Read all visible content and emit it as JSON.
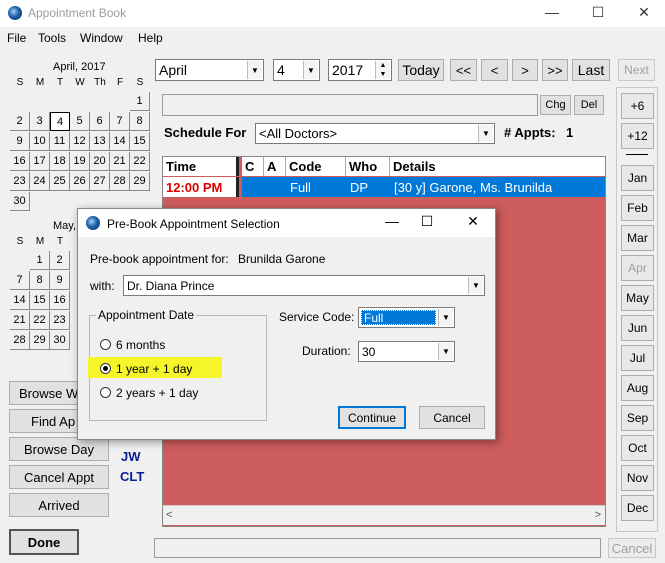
{
  "window": {
    "title": "Appointment Book",
    "minimize": "—",
    "maximize": "☐",
    "close": "✕"
  },
  "menu": [
    "File",
    "Tools",
    "Window",
    "Help"
  ],
  "toolbar": {
    "month": "April",
    "day": "4",
    "year": "2017",
    "today": "Today",
    "prev_prev": "<<",
    "prev": "<",
    "next": ">",
    "next_next": ">>",
    "last": "Last",
    "next_disabled": "Next"
  },
  "note_buttons": {
    "chg": "Chg",
    "del": "Del"
  },
  "schedule": {
    "label": "Schedule For",
    "value": "<All Doctors>",
    "appts_label": "# Appts:",
    "appts_count": "1"
  },
  "grid": {
    "columns": [
      "Time",
      "C",
      "A",
      "Code",
      "Who",
      "Details"
    ],
    "row": {
      "time": "12:00 PM",
      "code": "Full",
      "who": "DP",
      "details": "[30 y] Garone, Ms. Brunilda"
    }
  },
  "calendar_april": {
    "title": "April, 2017",
    "dow": [
      "S",
      "M",
      "T",
      "W",
      "Th",
      "F",
      "S"
    ],
    "weeks": [
      [
        "",
        "",
        "",
        "",
        "",
        "",
        "1"
      ],
      [
        "2",
        "3",
        "4",
        "5",
        "6",
        "7",
        "8"
      ],
      [
        "9",
        "10",
        "11",
        "12",
        "13",
        "14",
        "15"
      ],
      [
        "16",
        "17",
        "18",
        "19",
        "20",
        "21",
        "22"
      ],
      [
        "23",
        "24",
        "25",
        "26",
        "27",
        "28",
        "29"
      ],
      [
        "30",
        "",
        "",
        "",
        "",
        "",
        ""
      ]
    ],
    "selected": "4"
  },
  "calendar_may": {
    "title": "May,",
    "dow": [
      "S",
      "M",
      "T"
    ],
    "weeks": [
      [
        "",
        "1",
        "2"
      ],
      [
        "7",
        "8",
        "9"
      ],
      [
        "14",
        "15",
        "16"
      ],
      [
        "21",
        "22",
        "23"
      ],
      [
        "28",
        "29",
        "30"
      ]
    ]
  },
  "left_buttons": {
    "browse_week": "Browse W",
    "find_appt": "Find Ap",
    "browse_day": "Browse Day",
    "cancel_appt": "Cancel Appt",
    "arrived": "Arrived",
    "done": "Done"
  },
  "provider_codes": [
    "JW",
    "CLT"
  ],
  "right_panel": {
    "plus6": "+6",
    "plus12": "+12",
    "months": [
      "Jan",
      "Feb",
      "Mar",
      "Apr",
      "May",
      "Jun",
      "Jul",
      "Aug",
      "Sep",
      "Oct",
      "Nov",
      "Dec"
    ],
    "disabled_month": "Apr",
    "cancel": "Cancel"
  },
  "dialog": {
    "title": "Pre-Book Appointment Selection",
    "prebook_label": "Pre-book appointment for:",
    "patient": "Brunilda Garone",
    "with_label": "with:",
    "doctor": "Dr. Diana Prince",
    "group_label": "Appointment Date",
    "options": [
      "6 months",
      "1 year + 1 day",
      "2 years + 1 day"
    ],
    "selected_option": "1 year + 1 day",
    "service_label": "Service Code:",
    "service_value": "Full",
    "duration_label": "Duration:",
    "duration_value": "30",
    "continue": "Continue",
    "cancel": "Cancel"
  },
  "colors": {
    "highlight_row": "#0078d7",
    "grid_bg": "#cd5c5c",
    "time_red": "#e00000",
    "highlight_marker": "#f5f52a",
    "provider_blue": "#0a1f8f"
  }
}
